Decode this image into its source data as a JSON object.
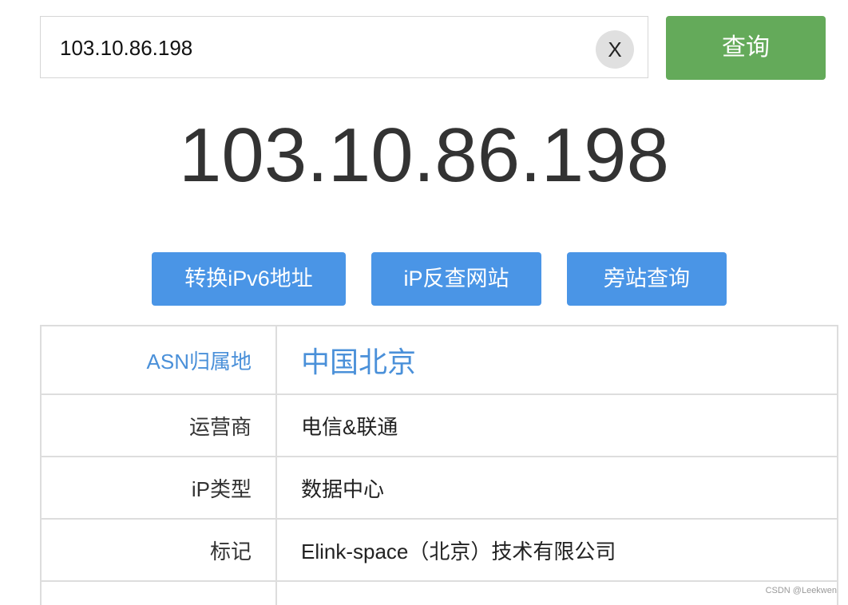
{
  "search": {
    "value": "103.10.86.198",
    "clear_label": "X",
    "query_label": "查询"
  },
  "result": {
    "ip": "103.10.86.198"
  },
  "actions": {
    "ipv6_label": "转换iPv6地址",
    "reverse_label": "iP反查网站",
    "side_label": "旁站查询"
  },
  "info": {
    "rows": [
      {
        "label": "ASN归属地",
        "value": "中国北京"
      },
      {
        "label": "运营商",
        "value": "电信&联通"
      },
      {
        "label": "iP类型",
        "value": "数据中心"
      },
      {
        "label": "标记",
        "value": "Elink-space（北京）技术有限公司"
      }
    ]
  },
  "watermark": "CSDN @Leekwen",
  "colors": {
    "query_button": "#64aa5a",
    "action_button": "#4a95e6",
    "accent_text": "#4a90d9"
  }
}
